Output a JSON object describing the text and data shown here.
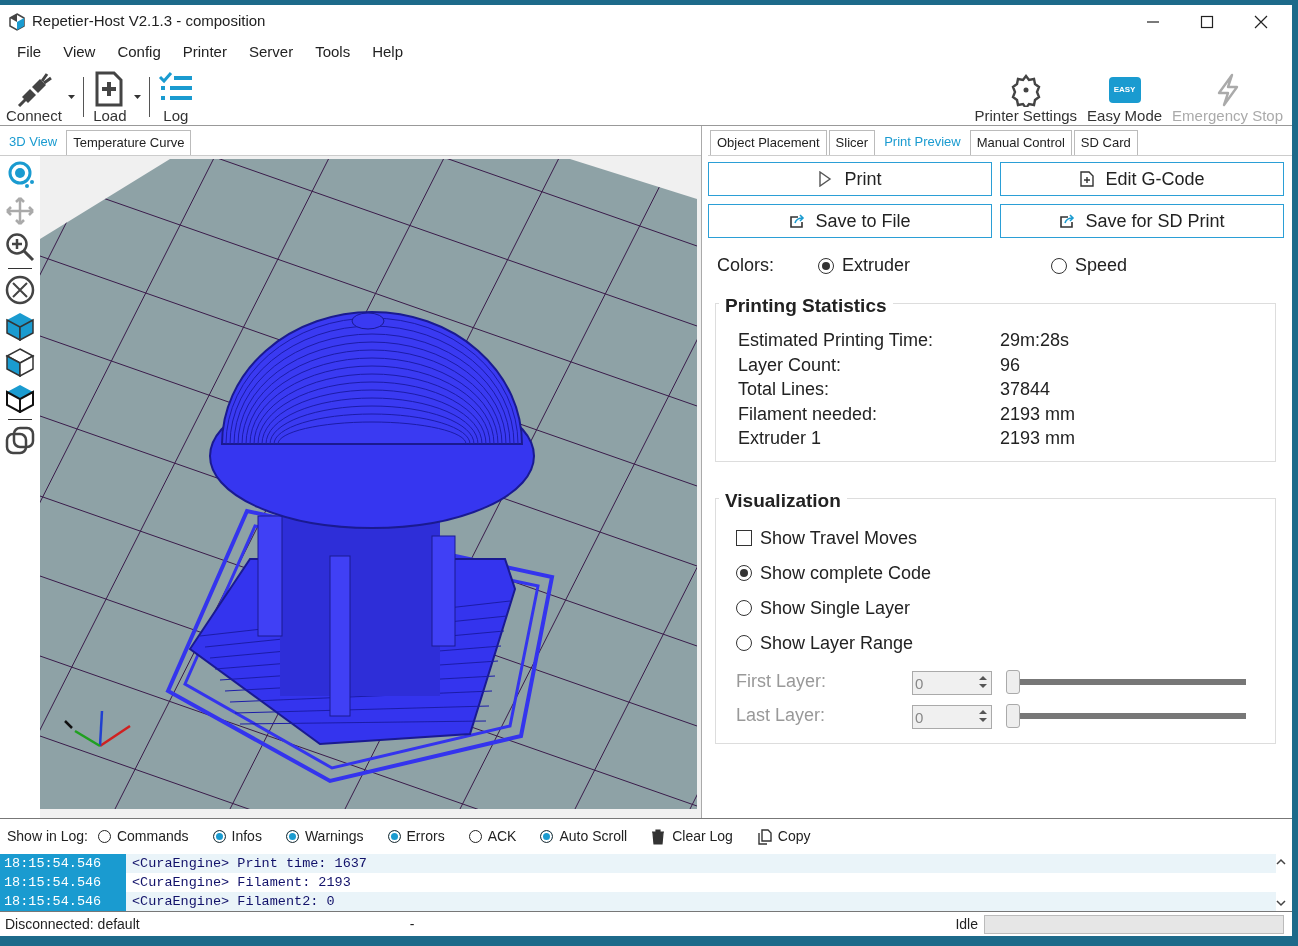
{
  "window": {
    "title": "Repetier-Host V2.1.3 - composition"
  },
  "menu": [
    "File",
    "View",
    "Config",
    "Printer",
    "Server",
    "Tools",
    "Help"
  ],
  "toolbar_left": [
    {
      "label": "Connect",
      "dropdown": true
    },
    {
      "label": "Load",
      "dropdown": true
    },
    {
      "label": "Log",
      "dropdown": false
    }
  ],
  "toolbar_right": [
    {
      "label": "Printer Settings",
      "disabled": false
    },
    {
      "label": "Easy Mode",
      "badge": "EASY",
      "disabled": false
    },
    {
      "label": "Emergency Stop",
      "disabled": true
    }
  ],
  "left_tabs": [
    {
      "label": "3D View",
      "selected": true
    },
    {
      "label": "Temperature Curve",
      "selected": false
    }
  ],
  "right_tabs": [
    {
      "label": "Object Placement",
      "selected": false
    },
    {
      "label": "Slicer",
      "selected": false
    },
    {
      "label": "Print Preview",
      "selected": true
    },
    {
      "label": "Manual Control",
      "selected": false
    },
    {
      "label": "SD Card",
      "selected": false
    }
  ],
  "actions": [
    {
      "label": "Print"
    },
    {
      "label": "Edit G-Code"
    },
    {
      "label": "Save to File"
    },
    {
      "label": "Save for SD Print"
    }
  ],
  "colors": {
    "label": "Colors:",
    "options": [
      {
        "label": "Extruder",
        "selected": true
      },
      {
        "label": "Speed",
        "selected": false
      }
    ]
  },
  "statistics": {
    "title": "Printing Statistics",
    "rows": [
      {
        "label": "Estimated Printing Time:",
        "value": "29m:28s"
      },
      {
        "label": "Layer Count:",
        "value": "96"
      },
      {
        "label": "Total Lines:",
        "value": "37844"
      },
      {
        "label": "Filament needed:",
        "value": "2193 mm"
      },
      {
        "label": "Extruder 1",
        "value": "2193 mm"
      }
    ]
  },
  "visualization": {
    "title": "Visualization",
    "options": [
      {
        "kind": "checkbox",
        "label": "Show Travel Moves",
        "checked": false
      },
      {
        "kind": "radio",
        "label": "Show complete Code",
        "selected": true
      },
      {
        "kind": "radio",
        "label": "Show Single Layer",
        "selected": false
      },
      {
        "kind": "radio",
        "label": "Show Layer Range",
        "selected": false
      }
    ],
    "layers": [
      {
        "label": "First Layer:",
        "value": "0",
        "level": 0,
        "disabled": true
      },
      {
        "label": "Last Layer:",
        "value": "0",
        "level": 0,
        "disabled": true
      }
    ]
  },
  "log": {
    "label": "Show in Log:",
    "filters": [
      {
        "label": "Commands",
        "checked": false
      },
      {
        "label": "Infos",
        "checked": true
      },
      {
        "label": "Warnings",
        "checked": true
      },
      {
        "label": "Errors",
        "checked": true
      },
      {
        "label": "ACK",
        "checked": false
      },
      {
        "label": "Auto Scroll",
        "checked": true
      }
    ],
    "actions": [
      "Clear Log",
      "Copy"
    ],
    "lines": [
      {
        "time": "18:15:54.546",
        "text": "<CuraEngine> Print time: 1637"
      },
      {
        "time": "18:15:54.546",
        "text": "<CuraEngine> Filament: 2193"
      },
      {
        "time": "18:15:54.546",
        "text": "<CuraEngine> Filament2: 0"
      }
    ]
  },
  "status": {
    "connection": "Disconnected: default",
    "middle": "-",
    "state": "Idle",
    "level": 0
  }
}
